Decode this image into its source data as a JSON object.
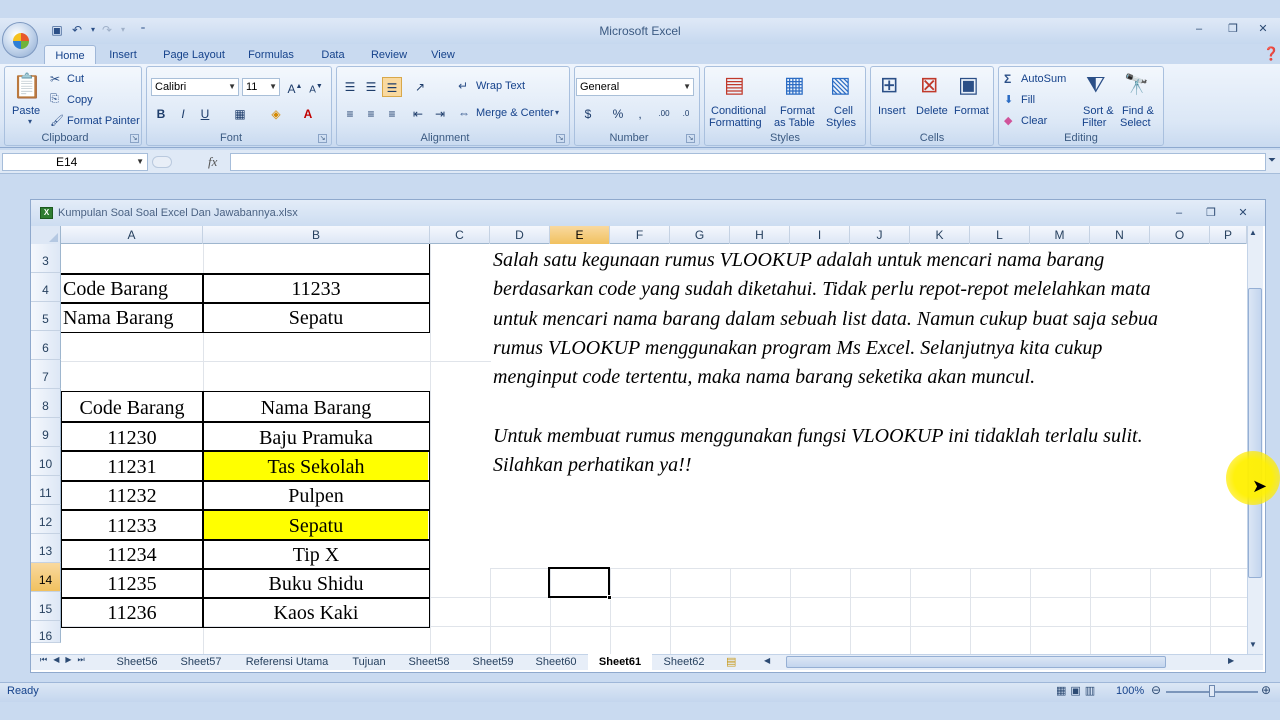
{
  "app": {
    "title": "Microsoft Excel"
  },
  "ribbon": {
    "tabs": [
      "Home",
      "Insert",
      "Page Layout",
      "Formulas",
      "Data",
      "Review",
      "View"
    ],
    "clipboard": {
      "label": "Clipboard",
      "paste": "Paste",
      "cut": "Cut",
      "copy": "Copy",
      "format_painter": "Format Painter"
    },
    "font": {
      "label": "Font",
      "name": "Calibri",
      "size": "11"
    },
    "alignment": {
      "label": "Alignment",
      "wrap_text": "Wrap Text",
      "merge_center": "Merge & Center"
    },
    "number": {
      "label": "Number",
      "format": "General"
    },
    "styles": {
      "label": "Styles",
      "cond_fmt_1": "Conditional",
      "cond_fmt_2": "Formatting",
      "fmt_table_1": "Format",
      "fmt_table_2": "as Table",
      "cell_styles_1": "Cell",
      "cell_styles_2": "Styles"
    },
    "cells": {
      "label": "Cells",
      "insert": "Insert",
      "delete": "Delete",
      "format": "Format"
    },
    "editing": {
      "label": "Editing",
      "autosum": "AutoSum",
      "fill": "Fill",
      "clear": "Clear",
      "sort_1": "Sort &",
      "sort_2": "Filter",
      "find_1": "Find &",
      "find_2": "Select"
    }
  },
  "formula_bar": {
    "name_box": "E14",
    "fx": "fx",
    "value": ""
  },
  "workbook": {
    "title": "Kumpulan Soal Soal Excel Dan Jawabannya.xlsx",
    "columns": [
      "A",
      "B",
      "C",
      "D",
      "E",
      "F",
      "G",
      "H",
      "I",
      "J",
      "K",
      "L",
      "M",
      "N",
      "O",
      "P"
    ],
    "selected_column": "E",
    "rows": [
      "3",
      "4",
      "5",
      "6",
      "7",
      "8",
      "9",
      "10",
      "11",
      "12",
      "13",
      "14",
      "15",
      "16"
    ],
    "selected_row": "14",
    "lookup": {
      "code_label": "Code Barang",
      "code_value": "11233",
      "name_label": "Nama Barang",
      "name_value": "Sepatu"
    },
    "table": {
      "headers": [
        "Code Barang",
        "Nama Barang"
      ],
      "rows": [
        [
          "11230",
          "Baju Pramuka"
        ],
        [
          "11231",
          "Tas Sekolah"
        ],
        [
          "11232",
          "Pulpen"
        ],
        [
          "11233",
          "Sepatu"
        ],
        [
          "11234",
          "Tip X"
        ],
        [
          "11235",
          "Buku Shidu"
        ],
        [
          "11236",
          "Kaos Kaki"
        ]
      ]
    },
    "description_lines": [
      "Salah satu kegunaan rumus VLOOKUP adalah untuk mencari nama barang",
      "berdasarkan code yang sudah diketahui. Tidak perlu repot-repot melelahkan mata",
      "untuk mencari nama barang dalam sebuah list data. Namun cukup buat saja sebua",
      "rumus VLOOKUP menggunakan program Ms Excel. Selanjutnya kita cukup",
      "menginput code tertentu, maka nama barang seketika akan muncul.",
      "",
      "Untuk membuat rumus menggunakan fungsi VLOOKUP ini tidaklah terlalu sulit.",
      "Silahkan perhatikan ya!!"
    ],
    "sheet_tabs": [
      "Sheet56",
      "Sheet57",
      "Referensi Utama",
      "Tujuan",
      "Sheet58",
      "Sheet59",
      "Sheet60",
      "Sheet61",
      "Sheet62"
    ],
    "active_sheet": "Sheet61"
  },
  "status": {
    "text": "Ready",
    "zoom": "100%"
  },
  "colors": {
    "highlight": "#ffff00",
    "ribbon_bg": "#dbe7f6",
    "selection_header": "#f1c15f"
  }
}
